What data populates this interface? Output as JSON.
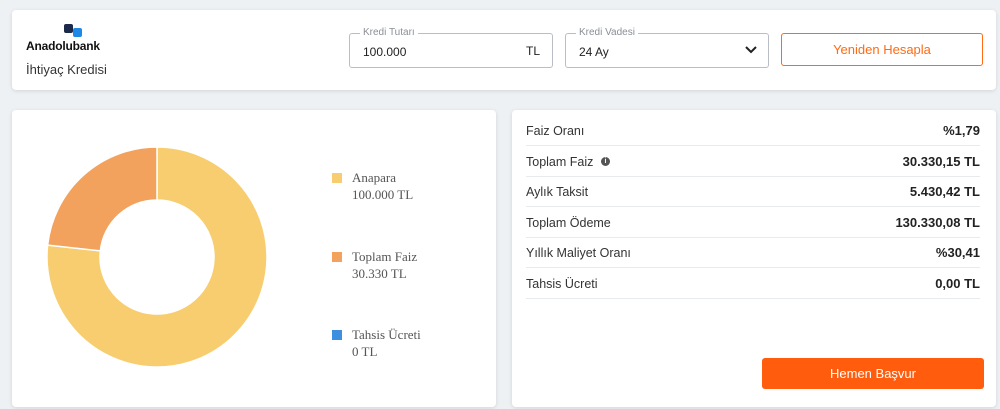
{
  "header": {
    "brand": "Anadolubank",
    "product": "İhtiyaç Kredisi",
    "amount": {
      "label": "Kredi Tutarı",
      "value": "100.000",
      "unit": "TL"
    },
    "term": {
      "label": "Kredi Vadesi",
      "value": "24 Ay"
    },
    "recalculate_label": "Yeniden Hesapla"
  },
  "chart_data": {
    "type": "pie",
    "categories": [
      "Anapara",
      "Toplam Faiz",
      "Tahsis Ücreti"
    ],
    "values": [
      100000,
      30330,
      0
    ],
    "value_labels": [
      "100.000 TL",
      "30.330 TL",
      "0 TL"
    ],
    "colors": [
      "#f7cd6f",
      "#f2a25d",
      "#3d8fe0"
    ],
    "legend": "right"
  },
  "results": {
    "rows": [
      {
        "label": "Faiz Oranı",
        "value": "%1,79"
      },
      {
        "label": "Toplam Faiz",
        "value": "30.330,15 TL"
      },
      {
        "label": "Aylık Taksit",
        "value": "5.430,42 TL"
      },
      {
        "label": "Toplam Ödeme",
        "value": "130.330,08 TL"
      },
      {
        "label": "Yıllık Maliyet Oranı",
        "value": "%30,41"
      },
      {
        "label": "Tahsis Ücreti",
        "value": "0,00 TL"
      }
    ],
    "apply_label": "Hemen Başvur"
  },
  "colors": {
    "accent": "#ff5c0d",
    "logo_dark": "#1b2a4a",
    "logo_blue": "#1e88e5"
  },
  "icons": {
    "info": "info-icon",
    "dropdown": "chevron-down-icon",
    "logo": "anadolubank-logo-icon"
  }
}
